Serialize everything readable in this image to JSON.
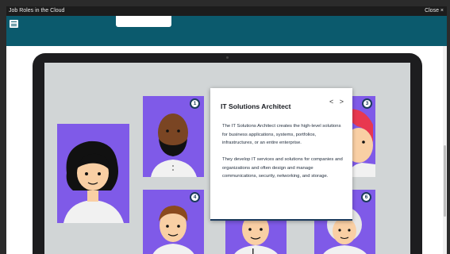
{
  "window": {
    "title": "Job Roles in the Cloud",
    "close_label": "Close ×"
  },
  "cards": [
    {
      "number": "1"
    },
    {
      "number": "3"
    },
    {
      "number": "4"
    },
    {
      "number": "6"
    }
  ],
  "popup": {
    "title": "IT Solutions Architect",
    "prev_icon": "chevron-left-icon",
    "next_icon": "chevron-right-icon",
    "prev_label": "<",
    "next_label": ">",
    "paragraphs": [
      "The IT Solutions Architect creates the high-level solutions for business applications, systems, portfolios, infrastructures, or an entire enterprise.",
      "They develop IT services and solutions for companies and organizations and often design and manage communications, security, networking, and storage."
    ]
  },
  "colors": {
    "header": "#0b5a6d",
    "card": "#7f5ae8",
    "screen": "#d1d5d6",
    "badge_border": "#1b3a5c"
  }
}
